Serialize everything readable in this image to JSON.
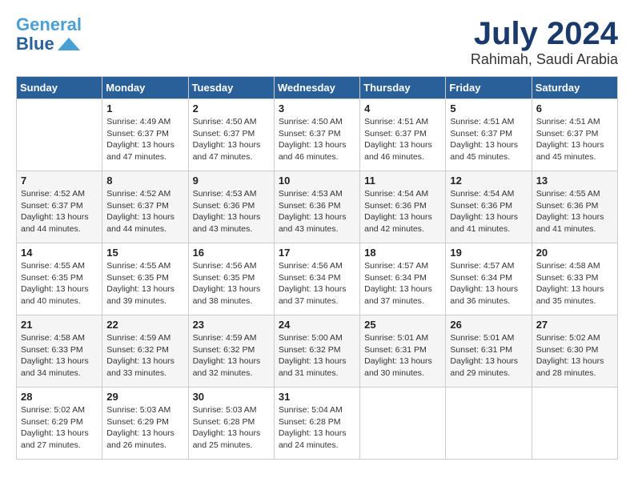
{
  "header": {
    "logo_line1": "General",
    "logo_line2": "Blue",
    "month": "July 2024",
    "location": "Rahimah, Saudi Arabia"
  },
  "weekdays": [
    "Sunday",
    "Monday",
    "Tuesday",
    "Wednesday",
    "Thursday",
    "Friday",
    "Saturday"
  ],
  "weeks": [
    [
      {
        "day": "",
        "info": ""
      },
      {
        "day": "1",
        "info": "Sunrise: 4:49 AM\nSunset: 6:37 PM\nDaylight: 13 hours\nand 47 minutes."
      },
      {
        "day": "2",
        "info": "Sunrise: 4:50 AM\nSunset: 6:37 PM\nDaylight: 13 hours\nand 47 minutes."
      },
      {
        "day": "3",
        "info": "Sunrise: 4:50 AM\nSunset: 6:37 PM\nDaylight: 13 hours\nand 46 minutes."
      },
      {
        "day": "4",
        "info": "Sunrise: 4:51 AM\nSunset: 6:37 PM\nDaylight: 13 hours\nand 46 minutes."
      },
      {
        "day": "5",
        "info": "Sunrise: 4:51 AM\nSunset: 6:37 PM\nDaylight: 13 hours\nand 45 minutes."
      },
      {
        "day": "6",
        "info": "Sunrise: 4:51 AM\nSunset: 6:37 PM\nDaylight: 13 hours\nand 45 minutes."
      }
    ],
    [
      {
        "day": "7",
        "info": "Sunrise: 4:52 AM\nSunset: 6:37 PM\nDaylight: 13 hours\nand 44 minutes."
      },
      {
        "day": "8",
        "info": "Sunrise: 4:52 AM\nSunset: 6:37 PM\nDaylight: 13 hours\nand 44 minutes."
      },
      {
        "day": "9",
        "info": "Sunrise: 4:53 AM\nSunset: 6:36 PM\nDaylight: 13 hours\nand 43 minutes."
      },
      {
        "day": "10",
        "info": "Sunrise: 4:53 AM\nSunset: 6:36 PM\nDaylight: 13 hours\nand 43 minutes."
      },
      {
        "day": "11",
        "info": "Sunrise: 4:54 AM\nSunset: 6:36 PM\nDaylight: 13 hours\nand 42 minutes."
      },
      {
        "day": "12",
        "info": "Sunrise: 4:54 AM\nSunset: 6:36 PM\nDaylight: 13 hours\nand 41 minutes."
      },
      {
        "day": "13",
        "info": "Sunrise: 4:55 AM\nSunset: 6:36 PM\nDaylight: 13 hours\nand 41 minutes."
      }
    ],
    [
      {
        "day": "14",
        "info": "Sunrise: 4:55 AM\nSunset: 6:35 PM\nDaylight: 13 hours\nand 40 minutes."
      },
      {
        "day": "15",
        "info": "Sunrise: 4:55 AM\nSunset: 6:35 PM\nDaylight: 13 hours\nand 39 minutes."
      },
      {
        "day": "16",
        "info": "Sunrise: 4:56 AM\nSunset: 6:35 PM\nDaylight: 13 hours\nand 38 minutes."
      },
      {
        "day": "17",
        "info": "Sunrise: 4:56 AM\nSunset: 6:34 PM\nDaylight: 13 hours\nand 37 minutes."
      },
      {
        "day": "18",
        "info": "Sunrise: 4:57 AM\nSunset: 6:34 PM\nDaylight: 13 hours\nand 37 minutes."
      },
      {
        "day": "19",
        "info": "Sunrise: 4:57 AM\nSunset: 6:34 PM\nDaylight: 13 hours\nand 36 minutes."
      },
      {
        "day": "20",
        "info": "Sunrise: 4:58 AM\nSunset: 6:33 PM\nDaylight: 13 hours\nand 35 minutes."
      }
    ],
    [
      {
        "day": "21",
        "info": "Sunrise: 4:58 AM\nSunset: 6:33 PM\nDaylight: 13 hours\nand 34 minutes."
      },
      {
        "day": "22",
        "info": "Sunrise: 4:59 AM\nSunset: 6:32 PM\nDaylight: 13 hours\nand 33 minutes."
      },
      {
        "day": "23",
        "info": "Sunrise: 4:59 AM\nSunset: 6:32 PM\nDaylight: 13 hours\nand 32 minutes."
      },
      {
        "day": "24",
        "info": "Sunrise: 5:00 AM\nSunset: 6:32 PM\nDaylight: 13 hours\nand 31 minutes."
      },
      {
        "day": "25",
        "info": "Sunrise: 5:01 AM\nSunset: 6:31 PM\nDaylight: 13 hours\nand 30 minutes."
      },
      {
        "day": "26",
        "info": "Sunrise: 5:01 AM\nSunset: 6:31 PM\nDaylight: 13 hours\nand 29 minutes."
      },
      {
        "day": "27",
        "info": "Sunrise: 5:02 AM\nSunset: 6:30 PM\nDaylight: 13 hours\nand 28 minutes."
      }
    ],
    [
      {
        "day": "28",
        "info": "Sunrise: 5:02 AM\nSunset: 6:29 PM\nDaylight: 13 hours\nand 27 minutes."
      },
      {
        "day": "29",
        "info": "Sunrise: 5:03 AM\nSunset: 6:29 PM\nDaylight: 13 hours\nand 26 minutes."
      },
      {
        "day": "30",
        "info": "Sunrise: 5:03 AM\nSunset: 6:28 PM\nDaylight: 13 hours\nand 25 minutes."
      },
      {
        "day": "31",
        "info": "Sunrise: 5:04 AM\nSunset: 6:28 PM\nDaylight: 13 hours\nand 24 minutes."
      },
      {
        "day": "",
        "info": ""
      },
      {
        "day": "",
        "info": ""
      },
      {
        "day": "",
        "info": ""
      }
    ]
  ]
}
